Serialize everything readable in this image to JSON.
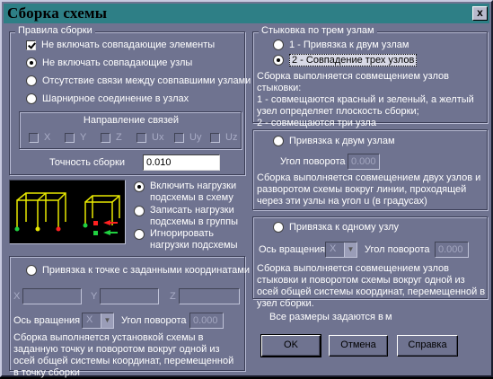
{
  "window": {
    "title": "Сборка схемы",
    "close_glyph": "x"
  },
  "rules": {
    "legend": "Правила сборки",
    "checkboxes": [
      {
        "label": "Не включать совпадающие элементы",
        "checked": true
      }
    ],
    "radios": [
      {
        "label": "Не включать совпадающие узлы",
        "checked": true
      },
      {
        "label": "Отсутствие связи между совпавшими узлами",
        "checked": false
      },
      {
        "label": "Шарнирное соединение в узлах",
        "checked": false
      }
    ],
    "directions": {
      "legend": "Направление связей",
      "items": [
        "X",
        "Y",
        "Z",
        "Ux",
        "Uy",
        "Uz"
      ]
    },
    "precision_label": "Точность сборки",
    "precision_value": "0.010"
  },
  "loads": {
    "options": [
      {
        "label": "Включить нагрузки подсхемы в схему",
        "checked": true
      },
      {
        "label": "Записать нагрузки подсхемы в группы",
        "checked": false
      },
      {
        "label": "Игнорировать нагрузки подсхемы",
        "checked": false
      }
    ]
  },
  "coords": {
    "radio_label": "Привязка к точке с заданными координатами",
    "x_label": "X",
    "y_label": "Y",
    "z_label": "Z",
    "axis_label": "Ось вращения",
    "axis_value": "X",
    "angle_label": "Угол поворота",
    "angle_value": "0.000",
    "description": "Сборка выполняется установкой схемы в заданную точку и поворотом вокруг одной из осей общей системы координат, перемещенной в точку сборки"
  },
  "three_nodes": {
    "legend": "Стыковка по трем узлам",
    "options": [
      {
        "label": "1 - Привязка к двум узлам",
        "checked": false
      },
      {
        "label": "2 - Совпадение трех узлов",
        "checked": true
      }
    ],
    "description_lines": [
      "Сборка выполняется совмещением узлов стыковки:",
      "1 - совмещаются красный и зеленый, а желтый узел определяет плоскость сборки;",
      "2 - совмещаются три узла"
    ]
  },
  "two_nodes": {
    "radio_label": "Привязка к двум узлам",
    "angle_label": "Угол поворота u",
    "angle_value": "0.000",
    "description": "Сборка выполняется совмещением двух узлов и разворотом схемы вокруг линии, проходящей через эти узлы  на угол u (в градусах)"
  },
  "one_node": {
    "radio_label": "Привязка к одному узлу",
    "axis_label": "Ось вращения",
    "axis_value": "X",
    "angle_label": "Угол поворота",
    "angle_value": "0.000",
    "description": "Сборка выполняется совмещением узлов стыковки и поворотом схемы вокруг одной из осей общей системы координат, перемещенной в узел сборки."
  },
  "footer": {
    "units_note": "Все размеры задаются в",
    "units_value": "м",
    "ok": "OK",
    "cancel": "Отмена",
    "help": "Справка"
  },
  "colors": {
    "dialog_bg": "#6f7390",
    "title_bar": "#2e7f86",
    "frame_yellow": "#e8e800",
    "node_red": "#ff2020",
    "node_green": "#20d040"
  }
}
